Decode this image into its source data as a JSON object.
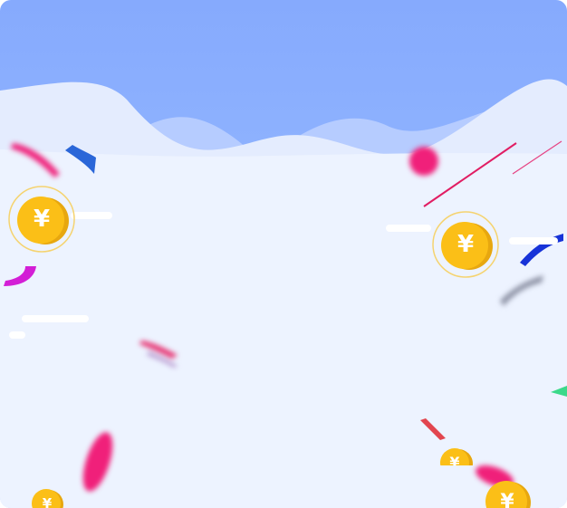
{
  "coin_symbol": "¥",
  "colors": {
    "sky": "#8aaefe",
    "background": "#edf3ff",
    "coin_gold": "#fbbf17",
    "coin_edge": "#e7a70f",
    "confetti_pink": "#f0207a",
    "confetti_blue": "#2a66d8",
    "confetti_magenta": "#d31ed6",
    "confetti_green": "#3bd98a",
    "confetti_red": "#e2454f"
  },
  "icons": [
    "coin-icon",
    "confetti-icon",
    "cloud-wave-icon"
  ]
}
